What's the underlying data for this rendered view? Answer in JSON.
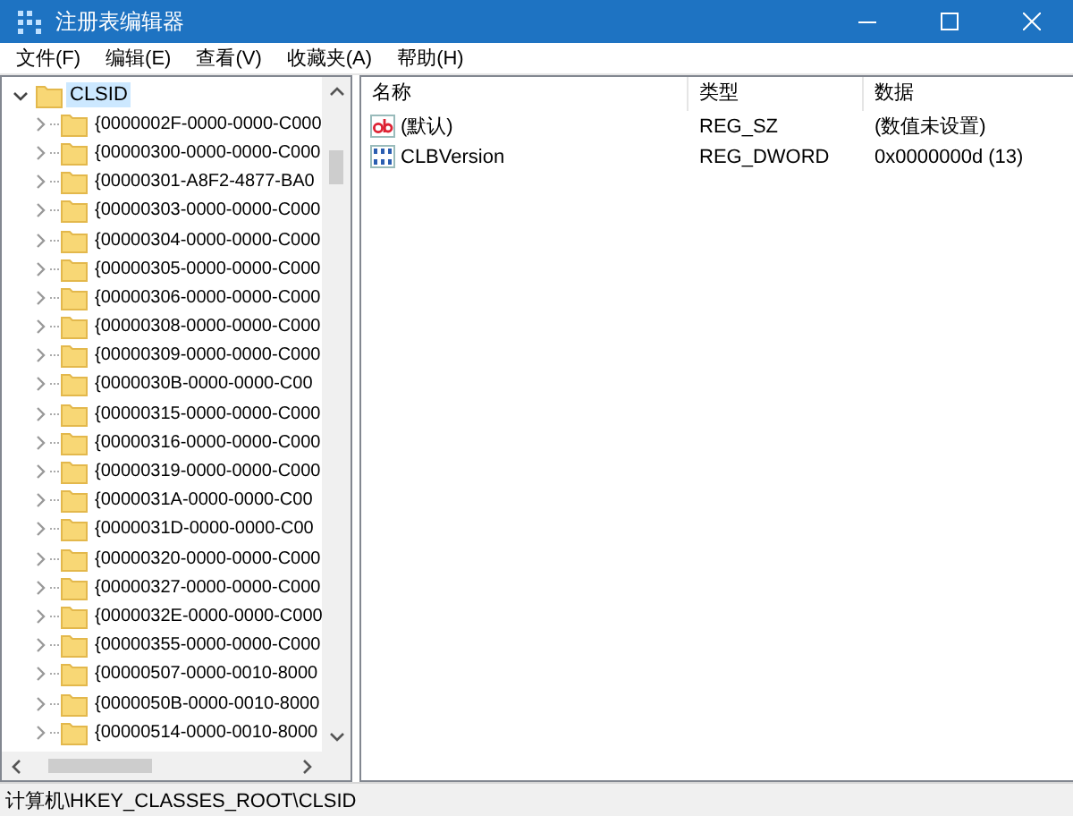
{
  "window": {
    "title": "注册表编辑器"
  },
  "menu": [
    "文件(F)",
    "编辑(E)",
    "查看(V)",
    "收藏夹(A)",
    "帮助(H)"
  ],
  "tree": {
    "label": "CLSID",
    "expanded": true,
    "selected": true,
    "children": [
      {
        "label": "{0000002F-0000-0000-C000",
        "expanded": false,
        "selected": false
      },
      {
        "label": "{00000300-0000-0000-C000",
        "expanded": false,
        "selected": false
      },
      {
        "label": "{00000301-A8F2-4877-BA0",
        "expanded": false,
        "selected": false
      },
      {
        "label": "{00000303-0000-0000-C000",
        "expanded": false,
        "selected": false
      },
      {
        "label": "{00000304-0000-0000-C000",
        "expanded": false,
        "selected": false
      },
      {
        "label": "{00000305-0000-0000-C000",
        "expanded": false,
        "selected": false
      },
      {
        "label": "{00000306-0000-0000-C000",
        "expanded": false,
        "selected": false
      },
      {
        "label": "{00000308-0000-0000-C000",
        "expanded": false,
        "selected": false
      },
      {
        "label": "{00000309-0000-0000-C000",
        "expanded": false,
        "selected": false
      },
      {
        "label": "{0000030B-0000-0000-C00",
        "expanded": false,
        "selected": false
      },
      {
        "label": "{00000315-0000-0000-C000",
        "expanded": false,
        "selected": false
      },
      {
        "label": "{00000316-0000-0000-C000",
        "expanded": false,
        "selected": false
      },
      {
        "label": "{00000319-0000-0000-C000",
        "expanded": false,
        "selected": false
      },
      {
        "label": "{0000031A-0000-0000-C00",
        "expanded": false,
        "selected": false
      },
      {
        "label": "{0000031D-0000-0000-C00",
        "expanded": false,
        "selected": false
      },
      {
        "label": "{00000320-0000-0000-C000",
        "expanded": false,
        "selected": false
      },
      {
        "label": "{00000327-0000-0000-C000",
        "expanded": false,
        "selected": false
      },
      {
        "label": "{0000032E-0000-0000-C000",
        "expanded": false,
        "selected": false
      },
      {
        "label": "{00000355-0000-0000-C000",
        "expanded": false,
        "selected": false
      },
      {
        "label": "{00000507-0000-0010-8000",
        "expanded": false,
        "selected": false
      },
      {
        "label": "{0000050B-0000-0010-8000",
        "expanded": false,
        "selected": false
      },
      {
        "label": "{00000514-0000-0010-8000",
        "expanded": false,
        "selected": false
      }
    ]
  },
  "table": {
    "columns": [
      "名称",
      "类型",
      "数据"
    ],
    "rows": [
      {
        "kind": "string",
        "name": "(默认)",
        "type": "REG_SZ",
        "data": "(数值未设置)"
      },
      {
        "kind": "binary",
        "name": "CLBVersion",
        "type": "REG_DWORD",
        "data": "0x0000000d (13)"
      }
    ]
  },
  "status_bar": "计算机\\HKEY_CLASSES_ROOT\\CLSID"
}
